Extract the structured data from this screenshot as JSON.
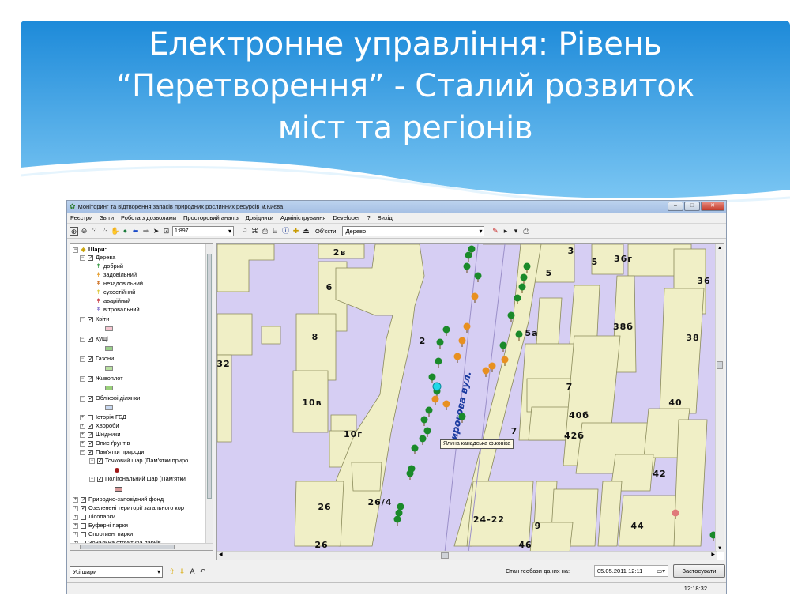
{
  "slide": {
    "title_lines": [
      "Електронне управління: Рівень",
      "“Перетворення” - Сталий розвиток",
      "міст та регіонів"
    ],
    "header_color_top": "#1a86d8",
    "header_color_bottom": "#79c5f3"
  },
  "window": {
    "title": "Моніторинг та відтворення запасів природних рослинних ресурсів м.Києва",
    "controls": [
      "minimize",
      "maximize",
      "close"
    ]
  },
  "menu": [
    "Реєстри",
    "Звіти",
    "Робота з дозволами",
    "Просторовий аналіз",
    "Довідники",
    "Адміністрування",
    "Developer",
    "?",
    "Вихід"
  ],
  "toolbar": {
    "scale_value": "1:897",
    "objects_label": "Об'єкти:",
    "objects_value": "Дерево"
  },
  "tree": {
    "root": "Шари:",
    "trees_layer": "Дерева",
    "tree_states": [
      {
        "label": "добрий",
        "color": "#1a8a2a"
      },
      {
        "label": "задовільний",
        "color": "#e08a00"
      },
      {
        "label": "незадовільний",
        "color": "#c8600a"
      },
      {
        "label": "сухостійний",
        "color": "#d8c020"
      },
      {
        "label": "аварійний",
        "color": "#c0202a"
      },
      {
        "label": "вітровальний",
        "color": "#7a6ac8"
      }
    ],
    "layers": [
      "Квіти",
      "Кущі",
      "Газони",
      "Живоплот",
      "Облікові ділянки",
      "Історія ГБД",
      "Хвороби",
      "Шкідники",
      "Опис ґрунтів",
      "Пам'ятки природи",
      "Точковий шар (Пам'ятки приро",
      "Полігональний шар (Пам'ятки",
      "Природно-заповідний фонд",
      "Озеленені території загального кор",
      "Лісопарки",
      "Буферні парки",
      "Спортивні парки",
      "Зональна структура парків"
    ]
  },
  "map": {
    "street_label": "Пирогова вул.",
    "tooltip": "Ялина канадська ф.коніка",
    "building_labels": [
      "2в",
      "6",
      "8",
      "2",
      "32",
      "10в",
      "10г",
      "26",
      "26/4",
      "26",
      "3",
      "5",
      "36г",
      "36",
      "5",
      "5а",
      "38б",
      "38",
      "7",
      "40б",
      "42б",
      "7",
      "40",
      "42",
      "24-22",
      "9",
      "44",
      "46"
    ],
    "bg_color": "#d6cef3",
    "building_color": "#f0efc6"
  },
  "bottom": {
    "layer_select": "Усі шари",
    "state_label": "Стан геобази даних на:",
    "date_value": "05.05.2011 12:11",
    "apply_button": "Застосувати",
    "status_time": "12:18:32"
  }
}
